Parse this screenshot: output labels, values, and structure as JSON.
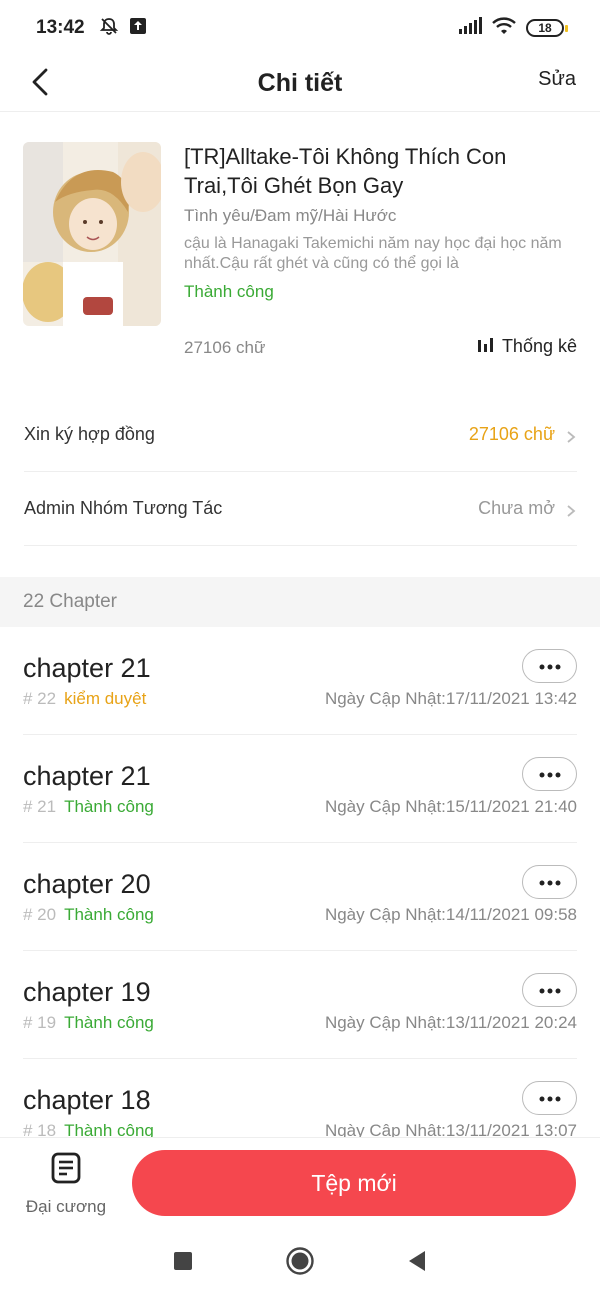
{
  "status_bar": {
    "time": "13:42",
    "battery": "18",
    "icons": [
      "mute-icon",
      "upload-icon",
      "signal-icon",
      "wifi-icon",
      "battery-icon"
    ]
  },
  "header": {
    "title": "Chi tiết",
    "edit_label": "Sửa",
    "back_icon": "back-arrow-icon"
  },
  "book": {
    "title": "[TR]Alltake-Tôi Không Thích Con Trai,Tôi Ghét Bọn Gay",
    "genre": "Tình yêu/Đam mỹ/Hài Hước",
    "description": "cậu là Hanagaki Takemichi  năm nay học đại học năm nhất.Cậu rất ghét và cũng có thể gọi là",
    "status": "Thành công",
    "word_count": "27106 chữ",
    "stats_label": "Thống kê"
  },
  "rows": [
    {
      "label": "Xin ký hợp đồng",
      "value": "27106 chữ",
      "value_color": "#e8a317"
    },
    {
      "label": "Admin Nhóm Tương Tác",
      "value": "Chưa mở",
      "value_color": "#999999"
    }
  ],
  "chapter_section": {
    "count_label": "22 Chapter"
  },
  "chapters": [
    {
      "name": "chapter 21",
      "num": "# 22",
      "status": "kiểm duyệt",
      "status_color": "#e8a317",
      "date": "Ngày Cập Nhật:17/11/2021 13:42"
    },
    {
      "name": "chapter 21",
      "num": "# 21",
      "status": "Thành công",
      "status_color": "#3aaa35",
      "date": "Ngày Cập Nhật:15/11/2021 21:40"
    },
    {
      "name": "chapter 20",
      "num": "# 20",
      "status": "Thành công",
      "status_color": "#3aaa35",
      "date": "Ngày Cập Nhật:14/11/2021 09:58"
    },
    {
      "name": "chapter 19",
      "num": "# 19",
      "status": "Thành công",
      "status_color": "#3aaa35",
      "date": "Ngày Cập Nhật:13/11/2021 20:24"
    },
    {
      "name": "chapter 18",
      "num": "# 18",
      "status": "Thành công",
      "status_color": "#3aaa35",
      "date": "Ngày Cập Nhật:13/11/2021 13:07"
    }
  ],
  "bottom_bar": {
    "outline_label": "Đại cương",
    "new_file_label": "Tệp mới",
    "accent": "#f5474e"
  }
}
